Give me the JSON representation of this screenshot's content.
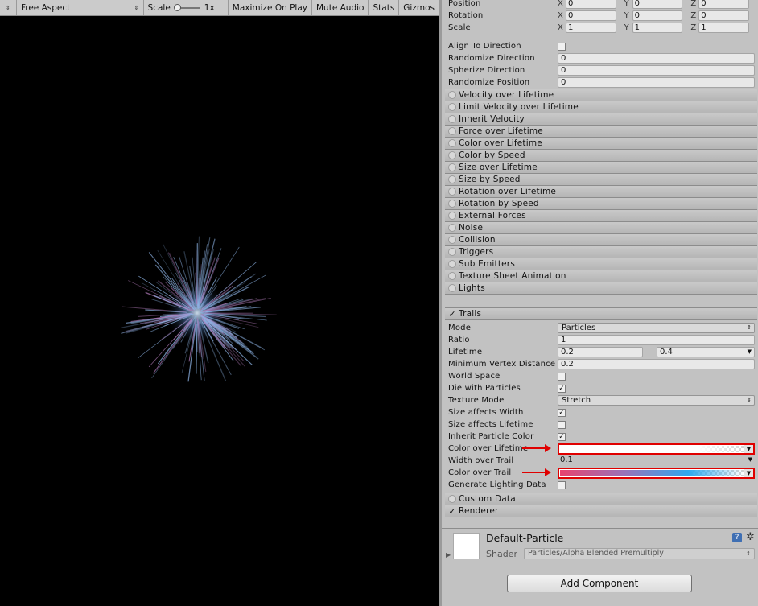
{
  "toolbar": {
    "display_arrows": "⇕",
    "aspect": "Free Aspect",
    "scale_label": "Scale",
    "scale_value": "1x",
    "maximize_on_play": "Maximize On Play",
    "mute_audio": "Mute Audio",
    "stats": "Stats",
    "gizmos": "Gizmos"
  },
  "shape": {
    "position_label": "Position",
    "rotation_label": "Rotation",
    "scale_label": "Scale",
    "axes": [
      "X",
      "Y",
      "Z"
    ],
    "position": [
      "0",
      "0",
      "0"
    ],
    "rotation": [
      "0",
      "0",
      "0"
    ],
    "scale": [
      "1",
      "1",
      "1"
    ],
    "align_to_direction_label": "Align To Direction",
    "randomize_direction_label": "Randomize Direction",
    "randomize_direction": "0",
    "spherize_direction_label": "Spherize Direction",
    "spherize_direction": "0",
    "randomize_position_label": "Randomize Position",
    "randomize_position": "0"
  },
  "modules": [
    "Velocity over Lifetime",
    "Limit Velocity over Lifetime",
    "Inherit Velocity",
    "Force over Lifetime",
    "Color over Lifetime",
    "Color by Speed",
    "Size over Lifetime",
    "Size by Speed",
    "Rotation over Lifetime",
    "Rotation by Speed",
    "External Forces",
    "Noise",
    "Collision",
    "Triggers",
    "Sub Emitters",
    "Texture Sheet Animation",
    "Lights"
  ],
  "trails": {
    "title": "Trails",
    "check": "✓",
    "mode_label": "Mode",
    "mode": "Particles",
    "ratio_label": "Ratio",
    "ratio": "1",
    "lifetime_label": "Lifetime",
    "lifetime_min": "0.2",
    "lifetime_max": "0.4",
    "min_vertex_label": "Minimum Vertex Distance",
    "min_vertex": "0.2",
    "world_space_label": "World Space",
    "die_with_particles_label": "Die with Particles",
    "texture_mode_label": "Texture Mode",
    "texture_mode": "Stretch",
    "size_affects_width_label": "Size affects Width",
    "size_affects_lifetime_label": "Size affects Lifetime",
    "inherit_color_label": "Inherit Particle Color",
    "color_over_lifetime_label": "Color over Lifetime",
    "width_over_trail_label": "Width over Trail",
    "width_over_trail": "0.1",
    "color_over_trail_label": "Color over Trail",
    "generate_lighting_label": "Generate Lighting Data"
  },
  "custom_data": {
    "title": "Custom Data"
  },
  "renderer": {
    "title": "Renderer",
    "check": "✓"
  },
  "material": {
    "name": "Default-Particle",
    "shader_label": "Shader",
    "shader": "Particles/Alpha Blended Premultiply",
    "help": "?",
    "gear": "✲"
  },
  "add_component": "Add Component",
  "colors": {
    "highlight": "#e00000",
    "trail_gradient_start": "#e8426e",
    "trail_gradient_end": "#2fa8ee",
    "particle_color": "#8fb6e8"
  }
}
